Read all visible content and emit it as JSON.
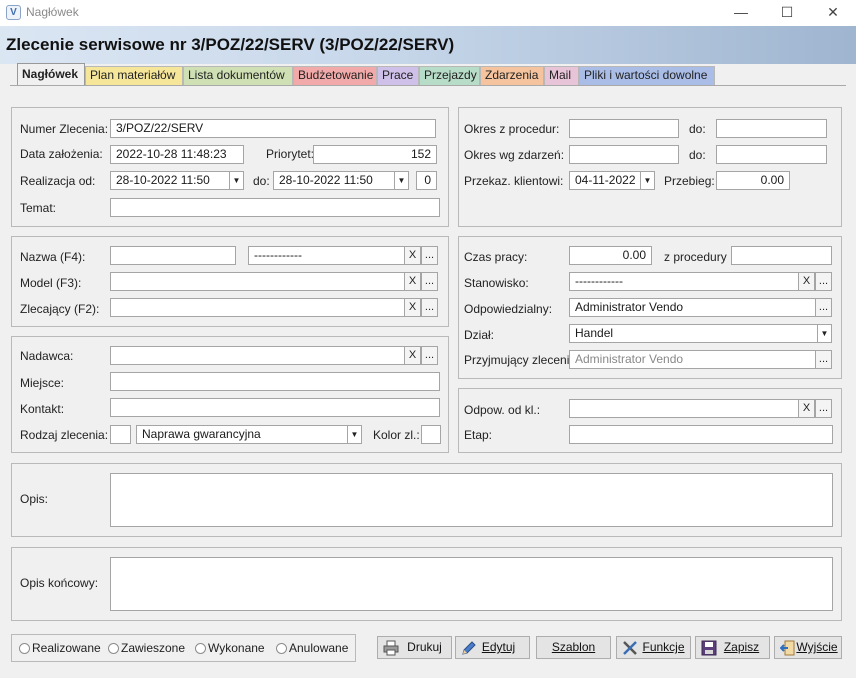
{
  "window": {
    "title": "Nagłówek",
    "minimize": "—",
    "maximize": "☐",
    "close": "✕"
  },
  "header": {
    "title": "Zlecenie serwisowe nr 3/POZ/22/SERV (3/POZ/22/SERV)"
  },
  "tabs": [
    {
      "label": "Nagłówek",
      "color": "#f0f0f0"
    },
    {
      "label": "Plan materiałów",
      "color": "#f6e69a"
    },
    {
      "label": "Lista dokumentów",
      "color": "#cfe0b4"
    },
    {
      "label": "Budżetowanie",
      "color": "#f2a9a9"
    },
    {
      "label": "Prace",
      "color": "#cfc0ea"
    },
    {
      "label": "Przejazdy",
      "color": "#b7dcc7"
    },
    {
      "label": "Zdarzenia",
      "color": "#f5c49e"
    },
    {
      "label": "Mail",
      "color": "#e8c4d8"
    },
    {
      "label": "Pliki i wartości dowolne",
      "color": "#a9bde6"
    }
  ],
  "general": {
    "order_number_label": "Numer Zlecenia:",
    "order_number": "3/POZ/22/SERV",
    "created_label": "Data założenia:",
    "created": "2022-10-28 11:48:23",
    "priority_label": "Priorytet:",
    "priority": "152",
    "realization_from_label": "Realizacja od:",
    "realization_from": "28-10-2022 11:50",
    "to_label": "do:",
    "realization_to": "28-10-2022 11:50",
    "days": "0",
    "subject_label": "Temat:",
    "subject": ""
  },
  "periods": {
    "procedure_label": "Okres z procedur:",
    "procedure_from": "",
    "procedure_to_label": "do:",
    "procedure_to": "",
    "events_label": "Okres wg zdarzeń:",
    "events_from": "",
    "events_to_label": "do:",
    "events_to": "",
    "handover_label": "Przekaz. klientowi:",
    "handover": "04-11-2022",
    "mileage_label": "Przebieg:",
    "mileage": "0.00"
  },
  "device": {
    "name_label": "Nazwa (F4):",
    "name": "",
    "name_code": "------------",
    "model_label": "Model (F3):",
    "model": "",
    "client_label": "Zlecający (F2):",
    "client": "",
    "clear": "X",
    "more": "..."
  },
  "work": {
    "time_label": "Czas pracy:",
    "time": "0.00",
    "from_procedure_label": "z procedury",
    "from_procedure": "",
    "station_label": "Stanowisko:",
    "station": "------------",
    "responsible_label": "Odpowiedzialny:",
    "responsible": "Administrator Vendo",
    "department_label": "Dział:",
    "department": "Handel",
    "receiver_label": "Przyjmujący zlecenie:",
    "receiver": "Administrator Vendo"
  },
  "sender": {
    "sender_label": "Nadawca:",
    "sender": "",
    "place_label": "Miejsce:",
    "place": "",
    "contact_label": "Kontakt:",
    "contact": "",
    "type_label": "Rodzaj zlecenia:",
    "type": "Naprawa gwarancyjna",
    "color_label": "Kolor zl.:"
  },
  "client_resp": {
    "resp_label": "Odpow. od kl.:",
    "resp": "",
    "stage_label": "Etap:",
    "stage": ""
  },
  "description": {
    "label": "Opis:",
    "value": ""
  },
  "final_description": {
    "label": "Opis końcowy:",
    "value": ""
  },
  "status": {
    "options": [
      "Realizowane",
      "Zawieszone",
      "Wykonane",
      "Anulowane"
    ]
  },
  "buttons": {
    "print": "Drukuj",
    "edit": "Edytuj",
    "template": "Szablon",
    "functions": "Funkcje",
    "save": "Zapisz",
    "exit": "Wyjście"
  },
  "icons": {
    "app": "vendo-logo-icon",
    "print": "printer-icon",
    "edit": "pencil-icon",
    "functions": "tools-icon",
    "save": "floppy-disk-icon",
    "exit": "exit-door-icon"
  }
}
